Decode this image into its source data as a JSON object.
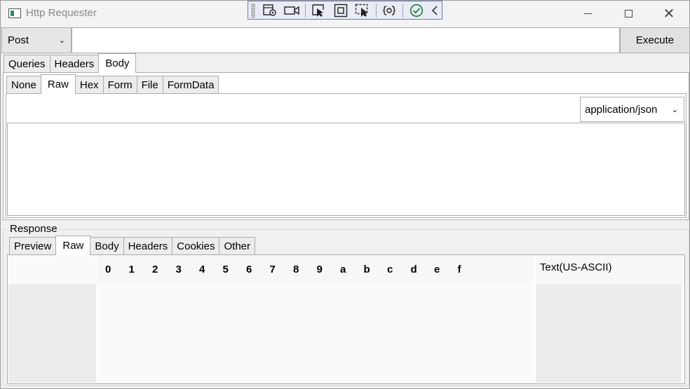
{
  "window": {
    "title": "Http Requester"
  },
  "request": {
    "method": "Post",
    "url": "",
    "execute_label": "Execute"
  },
  "request_tabs": [
    {
      "label": "Queries"
    },
    {
      "label": "Headers"
    },
    {
      "label": "Body"
    }
  ],
  "body_tabs": [
    {
      "label": "None"
    },
    {
      "label": "Raw"
    },
    {
      "label": "Hex"
    },
    {
      "label": "Form"
    },
    {
      "label": "File"
    },
    {
      "label": "FormData"
    }
  ],
  "content_type": "application/json",
  "response": {
    "label": "Response",
    "tabs": [
      {
        "label": "Preview"
      },
      {
        "label": "Raw"
      },
      {
        "label": "Body"
      },
      {
        "label": "Headers"
      },
      {
        "label": "Cookies"
      },
      {
        "label": "Other"
      }
    ],
    "hex_columns": [
      "0",
      "1",
      "2",
      "3",
      "4",
      "5",
      "6",
      "7",
      "8",
      "9",
      "a",
      "b",
      "c",
      "d",
      "e",
      "f"
    ],
    "ascii_header": "Text(US-ASCII)"
  }
}
